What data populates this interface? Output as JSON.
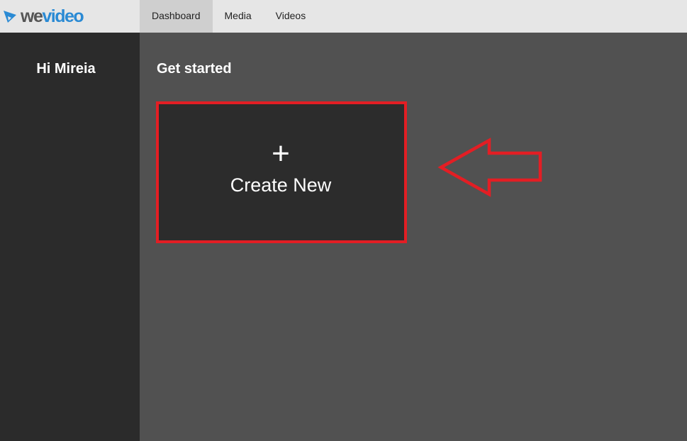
{
  "app": {
    "logo_we": "we",
    "logo_video": "video",
    "brand_color": "#2a8ad4"
  },
  "nav": {
    "tabs": [
      {
        "label": "Dashboard",
        "active": true
      },
      {
        "label": "Media",
        "active": false
      },
      {
        "label": "Videos",
        "active": false
      }
    ]
  },
  "sidebar": {
    "greeting": "Hi Mireia"
  },
  "main": {
    "section_title": "Get started",
    "create_card": {
      "icon": "plus-icon",
      "label": "Create New"
    }
  },
  "annotation": {
    "color": "#e31e24",
    "icon": "arrow-left-icon"
  }
}
